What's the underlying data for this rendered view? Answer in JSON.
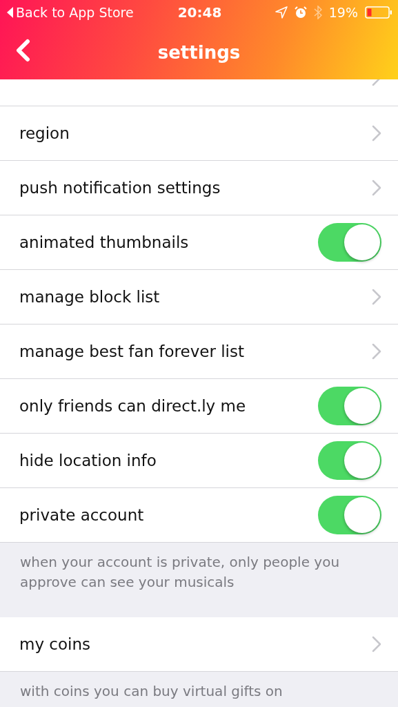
{
  "status_bar": {
    "back_label": "Back to App Store",
    "time": "20:48",
    "battery": "19%"
  },
  "nav": {
    "title": "settings"
  },
  "sections": [
    {
      "rows": [
        {
          "kind": "cut-link"
        },
        {
          "kind": "link",
          "label": "region"
        },
        {
          "kind": "link",
          "label": "push notification settings"
        },
        {
          "kind": "toggle",
          "label": "animated thumbnails",
          "on": true
        },
        {
          "kind": "link",
          "label": "manage block list"
        },
        {
          "kind": "link",
          "label": "manage best fan forever list"
        },
        {
          "kind": "toggle",
          "label": "only friends can direct.ly me",
          "on": true
        },
        {
          "kind": "toggle",
          "label": "hide location info",
          "on": true
        },
        {
          "kind": "toggle",
          "label": "private account",
          "on": true
        }
      ],
      "footer": "when your account is private, only people you approve can see your musicals"
    },
    {
      "rows": [
        {
          "kind": "link",
          "label": "my coins"
        }
      ],
      "footer": "with coins you can buy virtual gifts on"
    }
  ]
}
